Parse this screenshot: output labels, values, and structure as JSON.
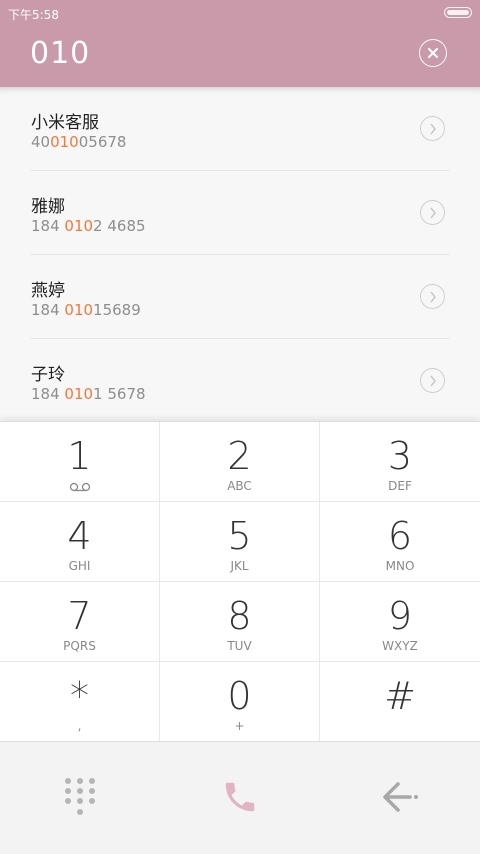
{
  "status": {
    "time": "下午5:58"
  },
  "dialer": {
    "input": "010"
  },
  "contacts": [
    {
      "name": "小米客服",
      "num_pre": "40",
      "num_hl": "010",
      "num_post": "05678"
    },
    {
      "name": "雅娜",
      "num_pre": "184 ",
      "num_hl": "010",
      "num_post": "2 4685"
    },
    {
      "name": "燕婷",
      "num_pre": "184 ",
      "num_hl": "010",
      "num_post": "15689"
    },
    {
      "name": "子玲",
      "num_pre": "184 ",
      "num_hl": "010",
      "num_post": "1 5678"
    }
  ],
  "keys": [
    {
      "digit": "1",
      "letters": ""
    },
    {
      "digit": "2",
      "letters": "ABC"
    },
    {
      "digit": "3",
      "letters": "DEF"
    },
    {
      "digit": "4",
      "letters": "GHI"
    },
    {
      "digit": "5",
      "letters": "JKL"
    },
    {
      "digit": "6",
      "letters": "MNO"
    },
    {
      "digit": "7",
      "letters": "PQRS"
    },
    {
      "digit": "8",
      "letters": "TUV"
    },
    {
      "digit": "9",
      "letters": "WXYZ"
    },
    {
      "digit": "*",
      "letters": ","
    },
    {
      "digit": "0",
      "letters": "+"
    },
    {
      "digit": "#",
      "letters": ""
    }
  ],
  "icons": {
    "voicemail": "voicemail-icon",
    "clear": "clear-icon",
    "arrow": "chevron-right-icon",
    "dialpad": "dialpad-icon",
    "call": "phone-icon",
    "back": "back-arrow-icon"
  },
  "colors": {
    "header": "#c99aa9",
    "highlight": "#f07a3a",
    "call": "#e2b3c2"
  }
}
